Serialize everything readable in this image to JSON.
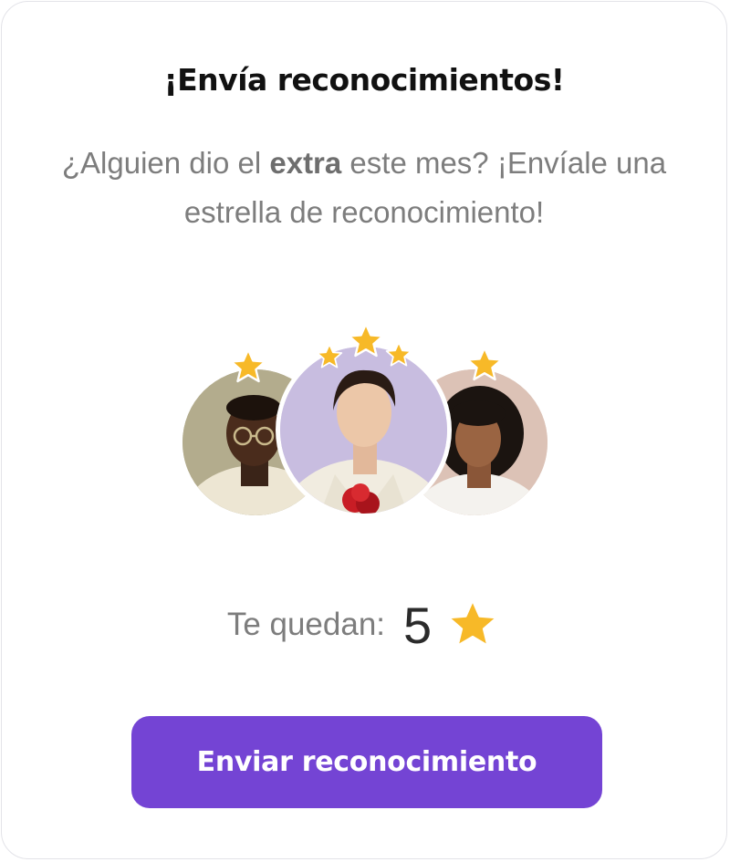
{
  "card": {
    "title": "¡Envía reconocimientos!",
    "subtitle_before": "¿Alguien dio el ",
    "subtitle_bold": "extra",
    "subtitle_after": " este mes? ¡Envíale una estrella de reconocimiento!"
  },
  "avatars": [
    {
      "name": "avatar-left",
      "stars": 1
    },
    {
      "name": "avatar-center",
      "stars": 3
    },
    {
      "name": "avatar-right",
      "stars": 1
    }
  ],
  "remaining": {
    "label": "Te quedan:",
    "count": "5",
    "icon": "star-icon"
  },
  "button": {
    "label": "Enviar reconocimiento"
  },
  "colors": {
    "accent": "#7444d4",
    "star": "#f7b928",
    "text_muted": "#7d7d7d"
  }
}
